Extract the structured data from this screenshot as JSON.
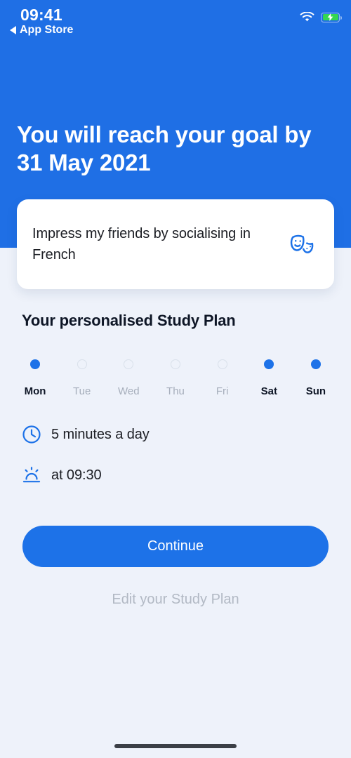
{
  "status_bar": {
    "time": "09:41",
    "back_label": "App Store",
    "back_icon": "triangle-left-icon",
    "wifi_icon": "wifi-icon",
    "battery_icon": "battery-charging-icon",
    "battery_color": "#34d651"
  },
  "header": {
    "headline": "You will reach your goal by 31 May 2021",
    "background_color": "#1f6fe5"
  },
  "goal_card": {
    "text": "Impress my friends by socialising in French",
    "icon": "theater-masks-icon",
    "icon_color": "#1d72e8"
  },
  "study_plan": {
    "title": "Your personalised Study Plan",
    "days": [
      {
        "label": "Mon",
        "selected": true
      },
      {
        "label": "Tue",
        "selected": false
      },
      {
        "label": "Wed",
        "selected": false
      },
      {
        "label": "Thu",
        "selected": false
      },
      {
        "label": "Fri",
        "selected": false
      },
      {
        "label": "Sat",
        "selected": true
      },
      {
        "label": "Sun",
        "selected": true
      }
    ],
    "duration": {
      "icon": "clock-icon",
      "text": "5 minutes a day"
    },
    "time": {
      "icon": "sunrise-icon",
      "text": "at 09:30"
    }
  },
  "actions": {
    "continue_label": "Continue",
    "continue_color": "#1d72e8",
    "edit_label": "Edit your Study Plan"
  }
}
